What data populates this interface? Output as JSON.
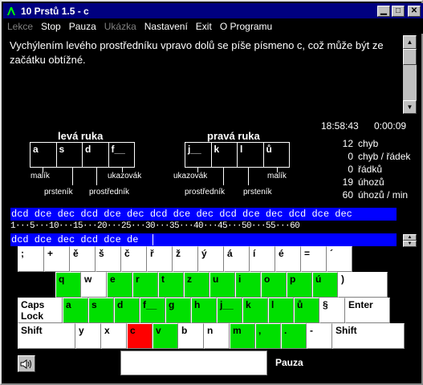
{
  "window": {
    "title": "10 Prstů 1.5 - c"
  },
  "menu": [
    {
      "label": "Lekce",
      "enabled": false
    },
    {
      "label": "Stop",
      "enabled": true
    },
    {
      "label": "Pauza",
      "enabled": true
    },
    {
      "label": "Ukázka",
      "enabled": false
    },
    {
      "label": "Nastavení",
      "enabled": true
    },
    {
      "label": "Exit",
      "enabled": true
    },
    {
      "label": "O Programu",
      "enabled": true
    }
  ],
  "message": "Vychýlením levého prostředníku vpravo dolů se píše písmeno c, což může být ze začátku obtížné.",
  "clock": "18:58:43",
  "elapsed": "0:00:09",
  "hands": {
    "left": {
      "title": "levá ruka",
      "keys": [
        "a",
        "s",
        "d",
        "f__"
      ],
      "fingers": {
        "pinky": "malík",
        "ring": "prsteník",
        "middle": "prostředník",
        "index": "ukazovák"
      }
    },
    "right": {
      "title": "pravá ruka",
      "keys": [
        "j__",
        "k",
        "l",
        "ů"
      ],
      "fingers": {
        "index": "ukazovák",
        "middle": "prostředník",
        "ring": "prsteník",
        "pinky": "malík"
      }
    }
  },
  "stats": [
    {
      "value": "12",
      "label": "chyb"
    },
    {
      "value": "0",
      "label": "chyb / řádek"
    },
    {
      "value": "0",
      "label": "řádků"
    },
    {
      "value": "19",
      "label": "úhozů"
    },
    {
      "value": "60",
      "label": "úhozů / min"
    }
  ],
  "exercise_text": "dcd dce dec dcd dce dec dcd dce dec dcd dce dec dcd dce dec",
  "ruler": "1···5···10···15···20···25···30···35···40···45···50···55···60",
  "typed_text": "dcd dce dec dcd dce de",
  "keyboard": {
    "colors": {
      "finger": "#00e000",
      "active": "#ff0000"
    },
    "rows": [
      [
        {
          "l": ";",
          "c": "w"
        },
        {
          "l": "+",
          "c": "w"
        },
        {
          "l": "ě",
          "c": "w"
        },
        {
          "l": "š",
          "c": "w"
        },
        {
          "l": "č",
          "c": "w"
        },
        {
          "l": "ř",
          "c": "w"
        },
        {
          "l": "ž",
          "c": "w"
        },
        {
          "l": "ý",
          "c": "w"
        },
        {
          "l": "á",
          "c": "w"
        },
        {
          "l": "í",
          "c": "w"
        },
        {
          "l": "é",
          "c": "w"
        },
        {
          "l": "=",
          "c": "w"
        },
        {
          "l": "´",
          "c": "w"
        }
      ],
      [
        {
          "l": "q",
          "c": "g"
        },
        {
          "l": "w",
          "c": "w"
        },
        {
          "l": "e",
          "c": "g"
        },
        {
          "l": "r",
          "c": "g"
        },
        {
          "l": "t",
          "c": "g"
        },
        {
          "l": "z",
          "c": "g"
        },
        {
          "l": "u",
          "c": "g"
        },
        {
          "l": "i",
          "c": "g"
        },
        {
          "l": "o",
          "c": "g"
        },
        {
          "l": "p",
          "c": "g"
        },
        {
          "l": "ú",
          "c": "g"
        },
        {
          "l": ")",
          "c": "w"
        }
      ],
      [
        {
          "l": "Caps Lock",
          "c": "w"
        },
        {
          "l": "a",
          "c": "g"
        },
        {
          "l": "s",
          "c": "g"
        },
        {
          "l": "d",
          "c": "g"
        },
        {
          "l": "f__",
          "c": "g"
        },
        {
          "l": "g",
          "c": "g"
        },
        {
          "l": "h",
          "c": "g"
        },
        {
          "l": "j__",
          "c": "g"
        },
        {
          "l": "k",
          "c": "g"
        },
        {
          "l": "l",
          "c": "g"
        },
        {
          "l": "ů",
          "c": "g"
        },
        {
          "l": "§",
          "c": "w"
        },
        {
          "l": "Enter",
          "c": "w"
        }
      ],
      [
        {
          "l": "Shift",
          "c": "w"
        },
        {
          "l": "y",
          "c": "w"
        },
        {
          "l": "x",
          "c": "w"
        },
        {
          "l": "c",
          "c": "r"
        },
        {
          "l": "v",
          "c": "g"
        },
        {
          "l": "b",
          "c": "w"
        },
        {
          "l": "n",
          "c": "w"
        },
        {
          "l": "m",
          "c": "g"
        },
        {
          "l": ",",
          "c": "g"
        },
        {
          "l": ".",
          "c": "g"
        },
        {
          "l": "-",
          "c": "w"
        },
        {
          "l": "Shift",
          "c": "w"
        }
      ]
    ]
  },
  "pause_label": "Pauza",
  "icons": {
    "app": "app-icon",
    "speaker": "speaker-icon"
  }
}
